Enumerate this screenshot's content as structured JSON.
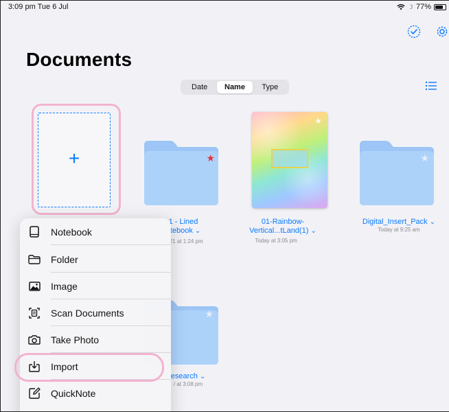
{
  "status_bar": {
    "time_date": "3:09 pm  Tue 6 Jul",
    "battery": "77%",
    "battery_level": 0.77,
    "icons": [
      "wifi-icon",
      "moon-icon",
      "battery-icon"
    ]
  },
  "toolbar": {
    "select_icon": "checkmark-circle-icon",
    "settings_icon": "gear-icon",
    "view_icon": "list-icon"
  },
  "page": {
    "title": "Documents"
  },
  "sort": {
    "options": [
      "Date",
      "Name",
      "Type"
    ],
    "selected": "Name"
  },
  "items": [
    {
      "kind": "new",
      "icon": "plus-icon"
    },
    {
      "kind": "folder",
      "name": "1 - Lined",
      "name2": "otebook",
      "date": "021 at 1:24 pm",
      "starred": true
    },
    {
      "kind": "notebook",
      "name": "01-Rainbow-",
      "name2": "Vertical...tLand(1)",
      "date": "Today at 3:05 pm",
      "starred": false
    },
    {
      "kind": "folder",
      "name": "Digital_Insert_Pack",
      "date": "Today at 9:25 am",
      "starred": false
    },
    {
      "kind": "folder",
      "name": "esearch",
      "date": "/ at 3:08 pm",
      "starred": false
    }
  ],
  "menu": {
    "items": [
      {
        "label": "Notebook",
        "icon": "notebook-icon"
      },
      {
        "label": "Folder",
        "icon": "folder-icon"
      },
      {
        "label": "Image",
        "icon": "image-icon"
      },
      {
        "label": "Scan Documents",
        "icon": "scan-document-icon"
      },
      {
        "label": "Take Photo",
        "icon": "camera-icon"
      },
      {
        "label": "Import",
        "icon": "import-icon"
      },
      {
        "label": "QuickNote",
        "icon": "quicknote-icon"
      }
    ]
  },
  "colors": {
    "accent": "#0a7aff",
    "highlight": "#f2b3cf",
    "folder": "#a9cdf7",
    "star_active": "#e5333b"
  }
}
